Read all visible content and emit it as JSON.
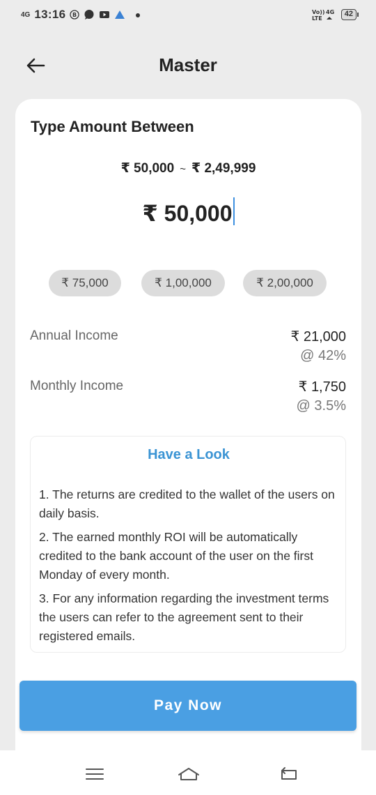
{
  "status_bar": {
    "network": "4G",
    "time": "13:16",
    "right_network_top": "Vo)) 4G",
    "right_network_bottom": "LTE",
    "battery": "42"
  },
  "header": {
    "title": "Master"
  },
  "form": {
    "section_title": "Type Amount Between",
    "range_min": "₹ 50,000",
    "range_sep": "~",
    "range_max": "₹ 2,49,999",
    "amount_value": "₹ 50,000"
  },
  "chips": [
    "₹ 75,000",
    "₹ 1,00,000",
    "₹ 2,00,000"
  ],
  "income": {
    "annual_label": "Annual Income",
    "annual_value": "₹ 21,000",
    "annual_rate": "@ 42%",
    "monthly_label": "Monthly Income",
    "monthly_value": "₹ 1,750",
    "monthly_rate": "@ 3.5%"
  },
  "info": {
    "title": "Have a Look",
    "items": [
      "1. The returns are credited to the wallet of the users on daily basis.",
      "2. The earned monthly ROI will be automatically credited to the bank account of the user on the first Monday of every month.",
      "3. For any information regarding the investment terms the users can refer to the agreement sent to their registered emails."
    ]
  },
  "actions": {
    "pay_label": "Pay Now"
  },
  "colors": {
    "accent": "#4a9fe3",
    "link": "#3b94d4",
    "chip_bg": "#dcdcdc",
    "page_bg": "#ececec"
  },
  "icons": [
    "back-arrow-icon",
    "menu-icon",
    "home-icon",
    "back-nav-icon"
  ]
}
